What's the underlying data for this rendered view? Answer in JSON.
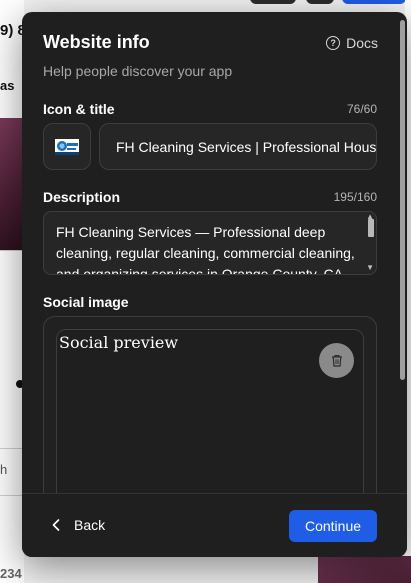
{
  "background": {
    "phone_fragment": "9) 8",
    "menu_fragment": "as",
    "small_fragment": "h",
    "number_fragment": "234"
  },
  "modal": {
    "title": "Website info",
    "docs_label": "Docs",
    "docs_icon": "question-circle-icon",
    "subtitle": "Help people discover your app",
    "icon_title": {
      "label": "Icon & title",
      "counter": "76/60",
      "title_value": "FH Cleaning Services | Professional House Cleaning"
    },
    "description": {
      "label": "Description",
      "counter": "195/160",
      "value": "FH Cleaning Services — Professional deep cleaning, regular cleaning, commercial cleaning, and organizing services in Orange County, CA."
    },
    "social_image": {
      "label": "Social image",
      "preview_text": "Social preview",
      "delete_icon": "trash-icon"
    },
    "footer": {
      "back_label": "Back",
      "back_icon": "chevron-left-icon",
      "continue_label": "Continue"
    }
  },
  "colors": {
    "modal_background": "#1f1f1f",
    "accent": "#1f5de6",
    "muted_text": "#a8a8a8",
    "border": "#3d3d3d"
  }
}
